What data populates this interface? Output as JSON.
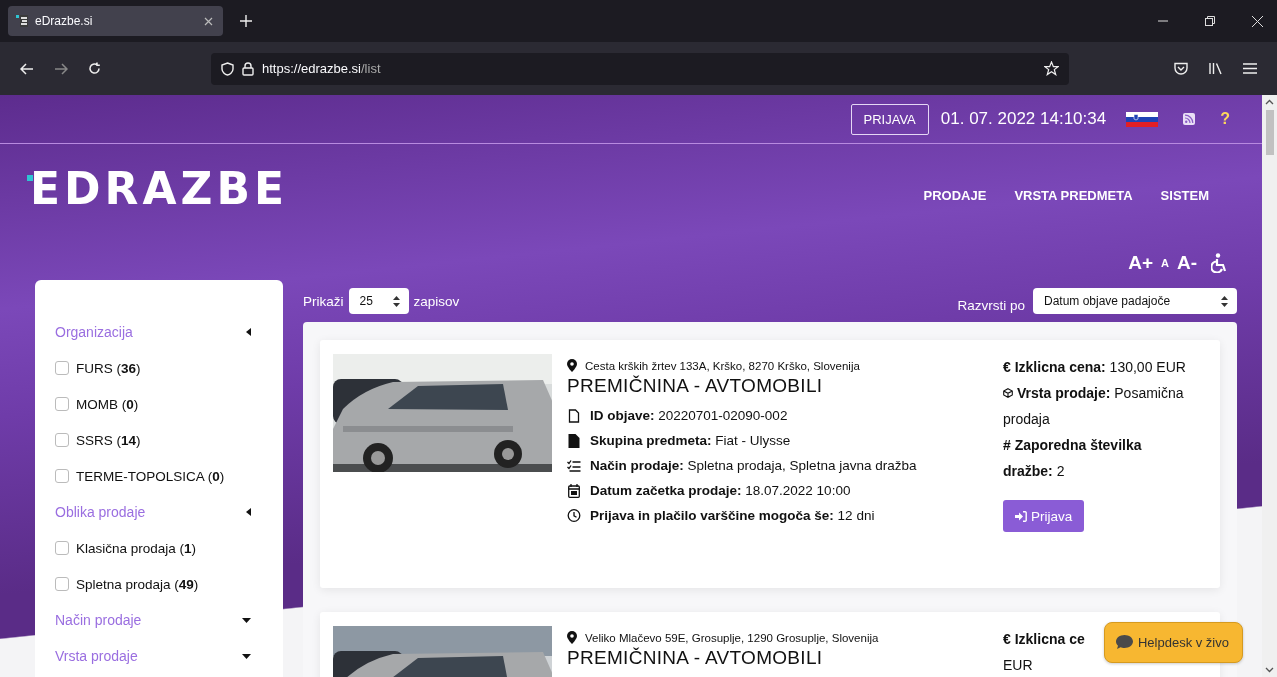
{
  "browser": {
    "tab_title": "eDrazbe.si",
    "url_host": "https://edrazbe.si",
    "url_path": "/list"
  },
  "topbar": {
    "login_button": "PRIJAVA",
    "datetime": "01. 07. 2022 14:10:34",
    "help": "?"
  },
  "logo": "EDRAZBE",
  "nav": [
    "PRODAJE",
    "VRSTA PREDMETA",
    "SISTEM"
  ],
  "font_controls": [
    {
      "label": "A+",
      "kind": "large"
    },
    {
      "label": "A",
      "kind": "small"
    },
    {
      "label": "A-",
      "kind": "large"
    }
  ],
  "list_controls": {
    "show_label": "Prikaži",
    "page_size": "25",
    "after_label": "zapisov",
    "sort_label": "Razvrsti po",
    "sort_value": "Datum objave padajoče"
  },
  "filters": [
    {
      "title": "Organizacija",
      "expanded": true,
      "options": [
        {
          "label": "FURS (**36**)",
          "checked": false
        },
        {
          "label": "MOMB (**0**)",
          "checked": false
        },
        {
          "label": "SSRS (**14**)",
          "checked": false
        },
        {
          "label": "TERME-TOPOLSICA (**0**)",
          "checked": false
        }
      ]
    },
    {
      "title": "Oblika prodaje",
      "expanded": true,
      "options": [
        {
          "label": "Klasična prodaja (**1**)",
          "checked": false
        },
        {
          "label": "Spletna prodaja (**49**)",
          "checked": false
        }
      ]
    },
    {
      "title": "Način prodaje",
      "expanded": false
    },
    {
      "title": "Vrsta prodaje",
      "expanded": false
    }
  ],
  "listings": [
    {
      "address": "Cesta krških žrtev 133A, Krško, 8270 Krško, Slovenija",
      "title": "PREMIČNINA - AVTOMOBILI",
      "details": [
        {
          "kind": "file",
          "text": "**ID objave:** 20220701-02090-002"
        },
        {
          "kind": "document",
          "text": "**Skupina predmeta:** Fiat - Ulysse"
        },
        {
          "kind": "list",
          "text": "**Način prodaje:** Spletna prodaja, Spletna javna dražba"
        },
        {
          "kind": "calendar",
          "text": "**Datum začetka prodaje:** 18.07.2022 10:00"
        },
        {
          "kind": "clock",
          "text": "**Prijava in plačilo varščine mogoča še:** 12 dni"
        }
      ],
      "side": [
        {
          "kind": "plain",
          "text": "**€ Izklicna cena:** 130,00 EUR"
        },
        {
          "kind": "box",
          "text": "**Vrsta prodaje:** Posamična prodaja"
        },
        {
          "kind": "plain",
          "text": "**# Zaporedna številka dražbe:** 2"
        }
      ],
      "button": "Prijava"
    },
    {
      "address": "Veliko Mlačevo 59E, Grosuplje, 1290 Grosuplje, Slovenija",
      "title": "PREMIČNINA - AVTOMOBILI",
      "side": [
        {
          "kind": "plain",
          "text": "**€ Izklicna ce**"
        },
        {
          "kind": "plain",
          "text": "EUR"
        }
      ]
    }
  ],
  "helpdesk": "Helpdesk v živo"
}
